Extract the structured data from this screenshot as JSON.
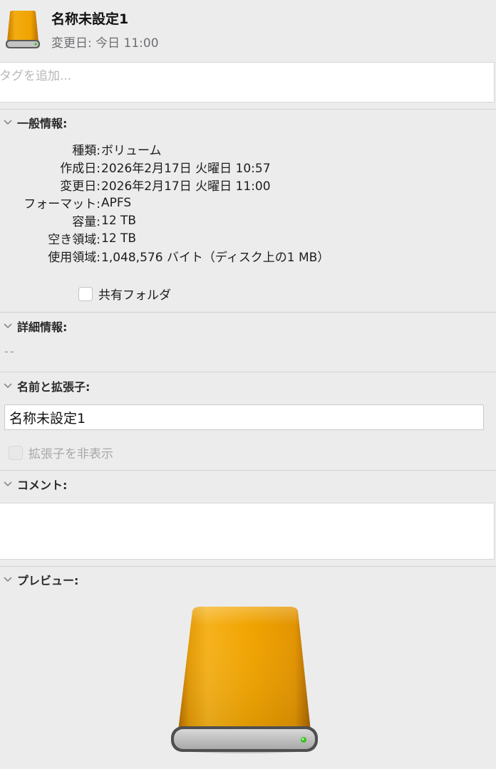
{
  "header": {
    "icon": "external-drive-icon",
    "title": "名称未設定1",
    "modified": "変更日: 今日 11:00"
  },
  "tags": {
    "placeholder": "タグを追加..."
  },
  "sections": {
    "general": "一般情報:",
    "more_info": "詳細情報:",
    "name_ext": "名前と拡張子:",
    "comments": "コメント:",
    "preview": "プレビュー:"
  },
  "general_info": {
    "rows": [
      {
        "label": "種類:",
        "value": "ボリューム"
      },
      {
        "label": "作成日:",
        "value": "2026年2月17日 火曜日 10:57"
      },
      {
        "label": "変更日:",
        "value": "2026年2月17日 火曜日 11:00"
      },
      {
        "label": "フォーマット:",
        "value": "APFS"
      },
      {
        "label": "容量:",
        "value": "12 TB"
      },
      {
        "label": "空き領域:",
        "value": "12 TB"
      },
      {
        "label": "使用領域:",
        "value": "1,048,576 バイト（ディスク上の1 MB）"
      }
    ],
    "shared_folder_label": "共有フォルダ",
    "shared_folder_checked": false
  },
  "more_info": {
    "value": "--"
  },
  "name_ext": {
    "name_value": "名称未設定1",
    "hide_ext_label": "拡張子を非表示",
    "hide_ext_checked": false,
    "hide_ext_disabled": true
  },
  "colors": {
    "drive_body": "#f0a300",
    "drive_face": "#b9b9b9",
    "led": "#39c21f",
    "background": "#ececec"
  }
}
